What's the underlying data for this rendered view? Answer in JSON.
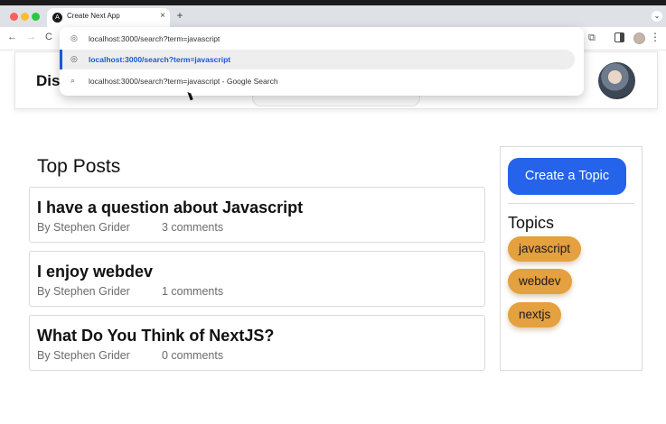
{
  "browser": {
    "tab": {
      "title": "Create Next App",
      "favicon": "A"
    },
    "new_tab": "+",
    "tab_menu": "⌄",
    "nav": {
      "back": "←",
      "forward": "→",
      "reload": "C"
    },
    "toolbar": {
      "extensions": "⧉",
      "more": "⋮"
    },
    "omnibox": {
      "input": "localhost:3000/search?term=javascript",
      "suggestions": [
        {
          "icon": "globe-icon",
          "text": "localhost:3000/search?term=javascript",
          "selected": true
        },
        {
          "icon": "search-icon",
          "text": "localhost:3000/search?term=javascript - Google Search",
          "selected": false
        }
      ]
    }
  },
  "header": {
    "brand_partial": "Dis"
  },
  "main": {
    "heading": "Top Posts",
    "posts": [
      {
        "title": "I have a question about Javascript",
        "author": "By Stephen Grider",
        "comments": "3 comments"
      },
      {
        "title": "I enjoy webdev",
        "author": "By Stephen Grider",
        "comments": "1 comments"
      },
      {
        "title": "What Do You Think of NextJS?",
        "author": "By Stephen Grider",
        "comments": "0 comments"
      }
    ]
  },
  "sidebar": {
    "create_button": "Create a Topic",
    "topics_heading": "Topics",
    "topics": [
      "javascript",
      "webdev",
      "nextjs"
    ]
  },
  "colors": {
    "accent": "#2563eb",
    "chip": "#e5a03f",
    "omnibox_selected": "#1a56db"
  }
}
